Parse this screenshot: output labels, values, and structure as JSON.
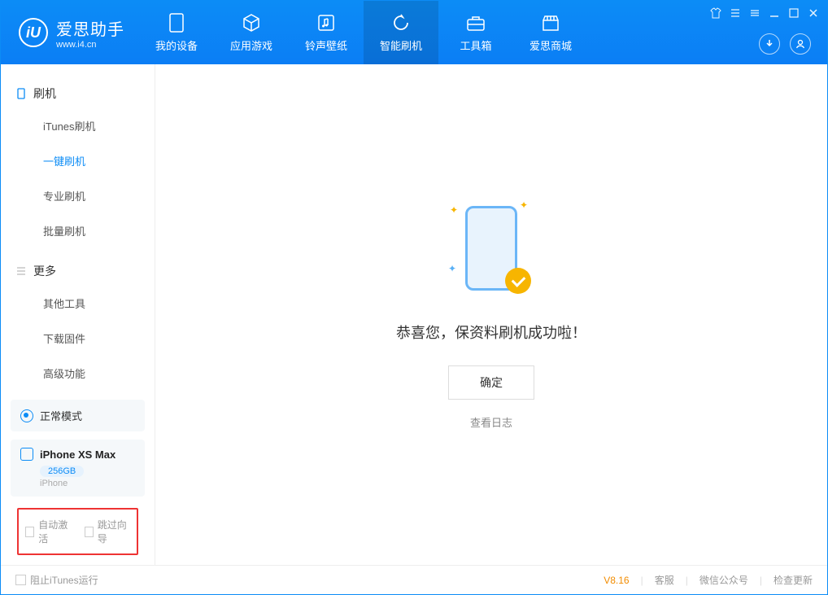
{
  "app": {
    "name": "爱思助手",
    "url": "www.i4.cn"
  },
  "tabs": [
    {
      "label": "我的设备",
      "icon": "device"
    },
    {
      "label": "应用游戏",
      "icon": "cube"
    },
    {
      "label": "铃声壁纸",
      "icon": "music"
    },
    {
      "label": "智能刷机",
      "icon": "refresh",
      "active": true
    },
    {
      "label": "工具箱",
      "icon": "toolbox"
    },
    {
      "label": "爱思商城",
      "icon": "store"
    }
  ],
  "sidebar": {
    "s1": {
      "title": "刷机",
      "items": [
        "iTunes刷机",
        "一键刷机",
        "专业刷机",
        "批量刷机"
      ],
      "activeIndex": 1
    },
    "s2": {
      "title": "更多",
      "items": [
        "其他工具",
        "下载固件",
        "高级功能"
      ]
    }
  },
  "status": {
    "mode": "正常模式"
  },
  "device": {
    "name": "iPhone XS Max",
    "storage": "256GB",
    "type": "iPhone"
  },
  "options": {
    "autoActivate": "自动激活",
    "skipGuide": "跳过向导"
  },
  "main": {
    "successMsg": "恭喜您，保资料刷机成功啦！",
    "okBtn": "确定",
    "logLink": "查看日志"
  },
  "footer": {
    "blockItunes": "阻止iTunes运行",
    "version": "V8.16",
    "links": [
      "客服",
      "微信公众号",
      "检查更新"
    ]
  }
}
